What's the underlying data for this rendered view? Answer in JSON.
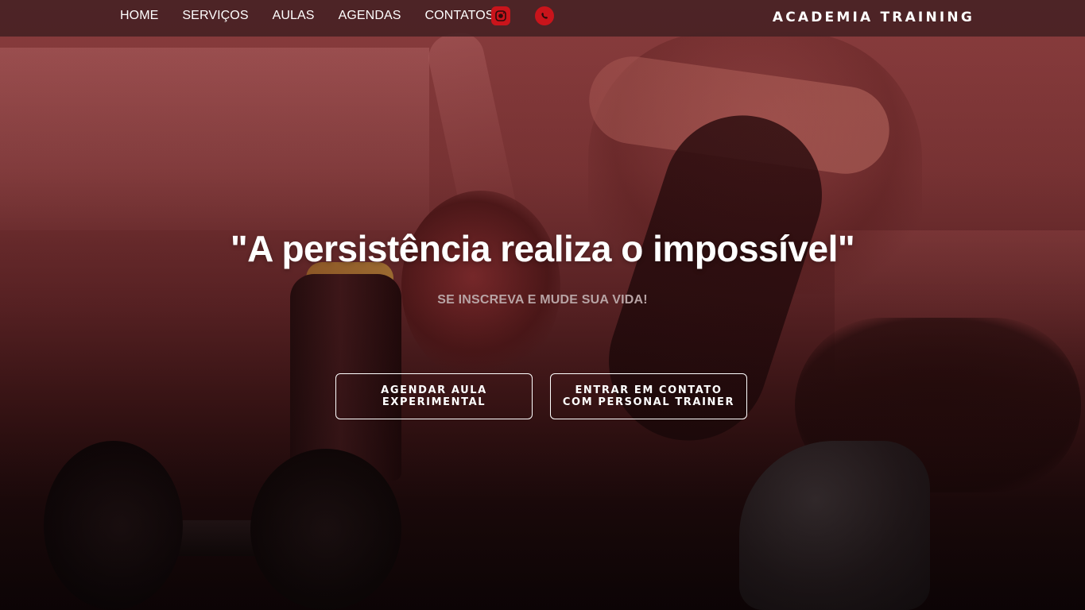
{
  "nav": {
    "links": [
      {
        "label": "HOME"
      },
      {
        "label": "SERVIÇOS"
      },
      {
        "label": "AULAS"
      },
      {
        "label": "AGENDAS"
      },
      {
        "label": "CONTATOS"
      }
    ],
    "social": [
      {
        "icon": "instagram-icon",
        "color": "#c9141b"
      },
      {
        "icon": "whatsapp-icon",
        "color": "#c9141b"
      }
    ],
    "brand": "ACADEMIA TRAINING"
  },
  "hero": {
    "headline": "\"A persistência realiza o impossível\"",
    "subheadline": "SE INSCREVA E MUDE SUA VIDA!",
    "buttons": [
      {
        "label": "AGENDAR AULA EXPERIMENTAL"
      },
      {
        "label": "ENTRAR EM CONTATO COM PERSONAL TRAINER"
      }
    ]
  },
  "colors": {
    "accent": "#c9141b",
    "navbar_bg": "#482224",
    "text": "#ffffff",
    "subtext": "#b8a4a5"
  }
}
